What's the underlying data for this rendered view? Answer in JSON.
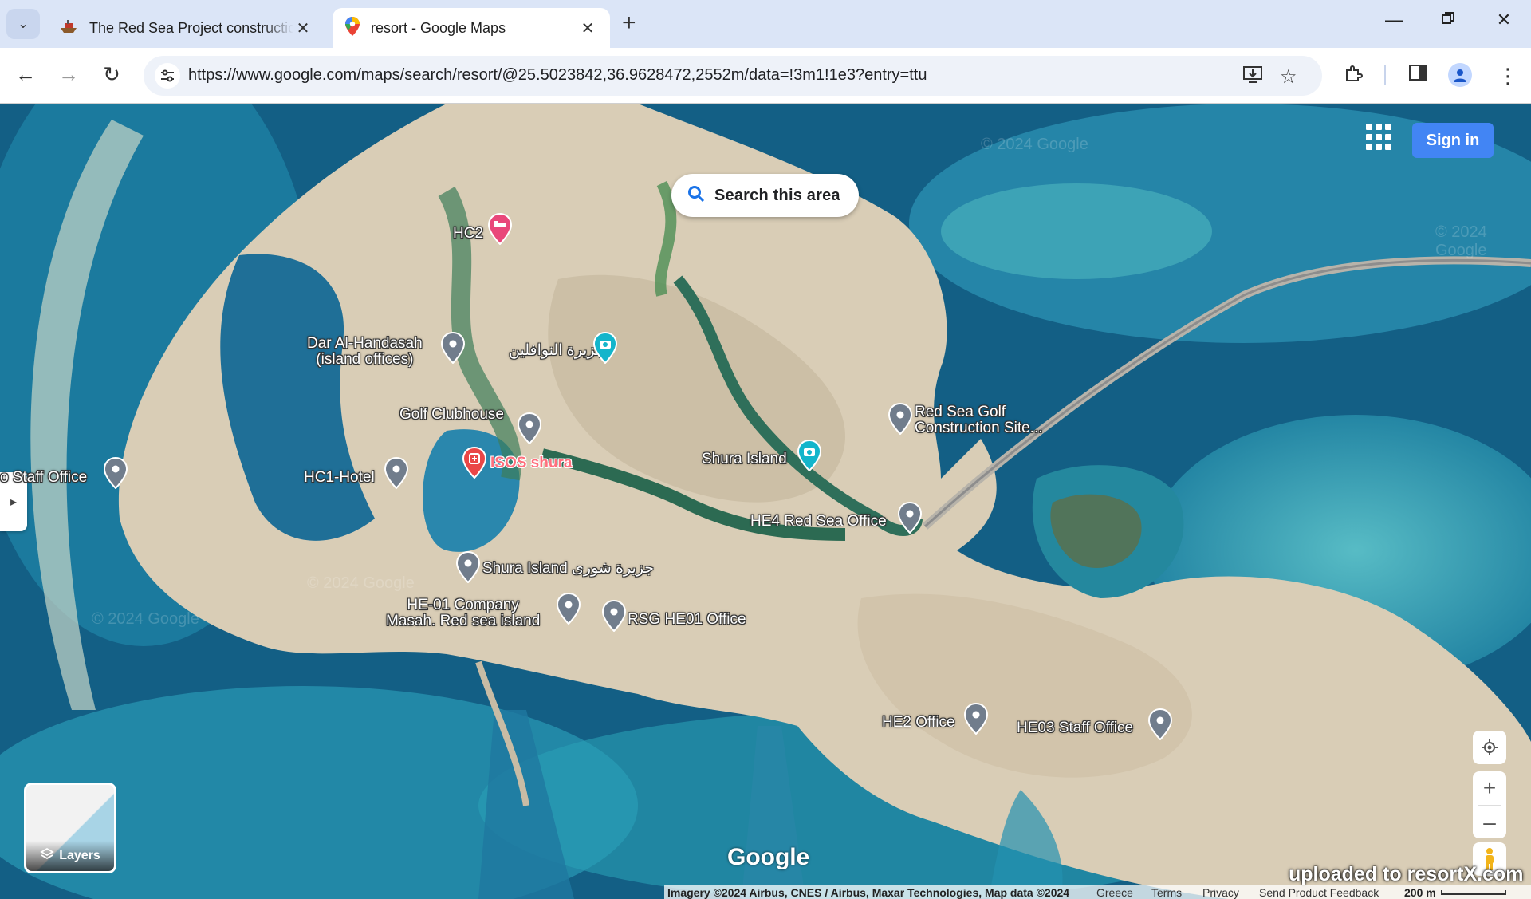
{
  "browser": {
    "tabs": [
      {
        "title": "The Red Sea Project construction",
        "active": false,
        "icon": "ship-favicon"
      },
      {
        "title": "resort - Google Maps",
        "active": true,
        "icon": "google-maps-favicon"
      }
    ],
    "url": "https://www.google.com/maps/search/resort/@25.5023842,36.9628472,2552m/data=!3m1!1e3?entry=ttu"
  },
  "map": {
    "sign_in_label": "Sign in",
    "search_area_label": "Search this area",
    "places": [
      {
        "name": "HC2",
        "pin": "hotel-pin"
      },
      {
        "name": "Dar Al-Handasah",
        "name2": "(island offices)",
        "pin": "gray-pin"
      },
      {
        "name": "جزيرة النوافلين",
        "pin": "camera-pin"
      },
      {
        "name": "Golf Clubhouse",
        "pin": "gray-pin"
      },
      {
        "name": "ISOS shura",
        "pin": "medical-pin"
      },
      {
        "name": "HC1-Hotel",
        "pin": "gray-pin"
      },
      {
        "name": "o Staff Office",
        "pin": "gray-pin"
      },
      {
        "name": "Shura Island",
        "pin": "camera-pin"
      },
      {
        "name": "Red Sea Golf",
        "name2": "Construction Site...",
        "pin": "gray-pin"
      },
      {
        "name": "HE4 Red Sea Office",
        "pin": "gray-pin"
      },
      {
        "name": "Shura Island جزيرة شورى",
        "pin": "gray-pin"
      },
      {
        "name": "HE-01 Company",
        "name2": "Masah. Red sea island",
        "pin": "gray-pin"
      },
      {
        "name": "RSG HE01 Office",
        "pin": "gray-pin"
      },
      {
        "name": "HE2 Office",
        "pin": "gray-pin"
      },
      {
        "name": "HE03 Staff Office",
        "pin": "gray-pin"
      }
    ],
    "layers_label": "Layers",
    "logo": "Google",
    "upload_watermark": "uploaded to resortX.com",
    "watermark_text": "© 2024 Google",
    "footer": {
      "imagery": "Imagery ©2024 Airbus, CNES / Airbus, Maxar Technologies, Map data ©2024",
      "country": "Greece",
      "terms": "Terms",
      "privacy": "Privacy",
      "feedback": "Send Product Feedback",
      "scale": "200 m"
    }
  }
}
